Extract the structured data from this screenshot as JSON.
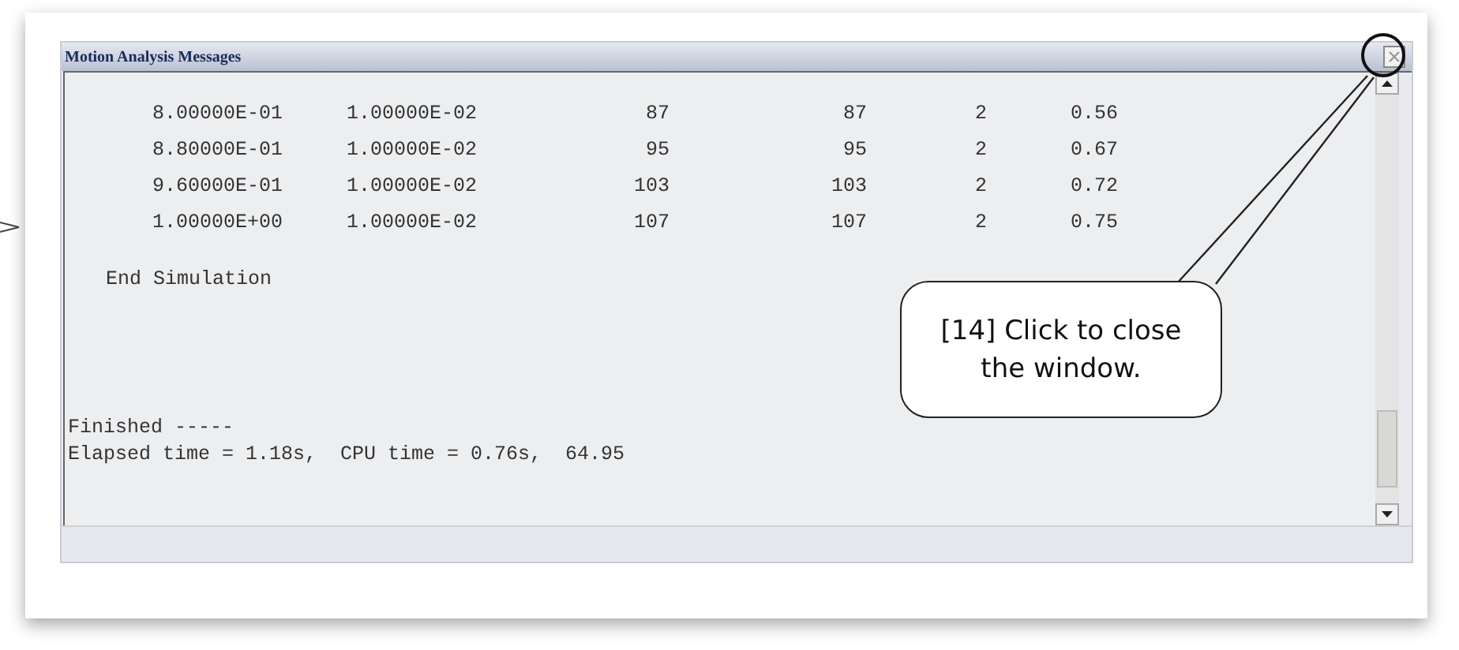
{
  "window": {
    "title": "Motion Analysis Messages"
  },
  "rows": [
    [
      "8.00000E-01",
      "1.00000E-02",
      "87",
      "87",
      "2",
      "0.56"
    ],
    [
      "8.80000E-01",
      "1.00000E-02",
      "95",
      "95",
      "2",
      "0.67"
    ],
    [
      "9.60000E-01",
      "1.00000E-02",
      "103",
      "103",
      "2",
      "0.72"
    ],
    [
      "1.00000E+00",
      "1.00000E-02",
      "107",
      "107",
      "2",
      "0.75"
    ]
  ],
  "end_message": "End Simulation",
  "finished": "Finished -----",
  "summary": "Elapsed time = 1.18s,  CPU time = 0.76s,  64.95",
  "callout": {
    "line_1": "[14] Click to close",
    "line_2": "the window."
  }
}
